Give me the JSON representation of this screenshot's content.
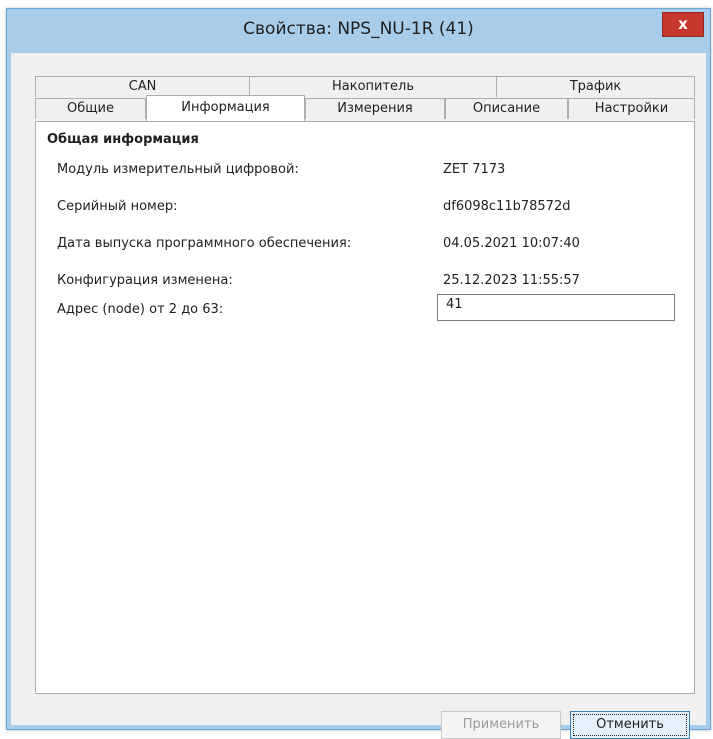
{
  "window": {
    "title": "Свойства: NPS_NU-1R (41)",
    "close_label": "x"
  },
  "tabs": {
    "row1": [
      {
        "label": "CAN"
      },
      {
        "label": "Накопитель"
      },
      {
        "label": "Трафик"
      }
    ],
    "row2": [
      {
        "label": "Общие"
      },
      {
        "label": "Информация",
        "active": true
      },
      {
        "label": "Измерения"
      },
      {
        "label": "Описание"
      },
      {
        "label": "Настройки"
      }
    ]
  },
  "info": {
    "section_title": "Общая информация",
    "rows": [
      {
        "label": "Модуль измерительный цифровой:",
        "value": "ZET 7173"
      },
      {
        "label": "Серийный номер:",
        "value": "df6098c11b78572d"
      },
      {
        "label": "Дата выпуска программного обеспечения:",
        "value": "04.05.2021 10:07:40"
      },
      {
        "label": "Конфигурация изменена:",
        "value": "25.12.2023 11:55:57"
      }
    ],
    "node": {
      "label": "Адрес (node) от 2 до 63:",
      "value": "41"
    }
  },
  "buttons": {
    "apply": "Применить",
    "cancel": "Отменить"
  }
}
